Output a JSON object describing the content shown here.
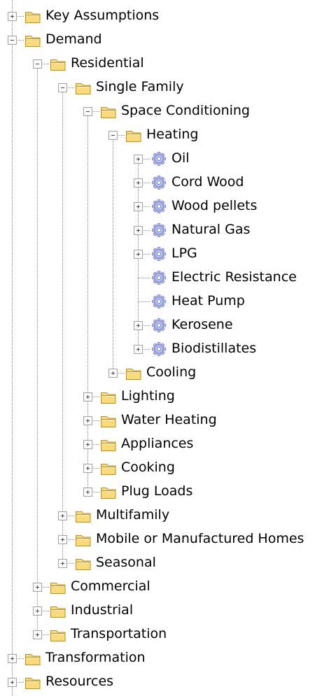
{
  "tree": {
    "items": [
      {
        "label": "Key Assumptions",
        "icon": "folder-icon",
        "state": "collapsed"
      },
      {
        "label": "Demand",
        "icon": "folder-icon",
        "state": "expanded"
      },
      {
        "label": "Residential",
        "icon": "folder-icon",
        "state": "expanded"
      },
      {
        "label": "Single Family",
        "icon": "folder-icon",
        "state": "expanded"
      },
      {
        "label": "Space Conditioning",
        "icon": "folder-icon",
        "state": "expanded"
      },
      {
        "label": "Heating",
        "icon": "folder-icon",
        "state": "expanded"
      },
      {
        "label": "Oil",
        "icon": "gear-icon",
        "state": "collapsed"
      },
      {
        "label": "Cord Wood",
        "icon": "gear-icon",
        "state": "collapsed"
      },
      {
        "label": "Wood pellets",
        "icon": "gear-icon",
        "state": "collapsed"
      },
      {
        "label": "Natural Gas",
        "icon": "gear-icon",
        "state": "collapsed"
      },
      {
        "label": "LPG",
        "icon": "gear-icon",
        "state": "collapsed"
      },
      {
        "label": "Electric Resistance",
        "icon": "gear-icon",
        "state": "leaf"
      },
      {
        "label": "Heat Pump",
        "icon": "gear-icon",
        "state": "leaf"
      },
      {
        "label": "Kerosene",
        "icon": "gear-icon",
        "state": "collapsed"
      },
      {
        "label": "Biodistillates",
        "icon": "gear-icon",
        "state": "collapsed"
      },
      {
        "label": "Cooling",
        "icon": "folder-icon",
        "state": "collapsed"
      },
      {
        "label": "Lighting",
        "icon": "folder-icon",
        "state": "collapsed"
      },
      {
        "label": "Water Heating",
        "icon": "folder-icon",
        "state": "collapsed"
      },
      {
        "label": "Appliances",
        "icon": "folder-icon",
        "state": "collapsed"
      },
      {
        "label": "Cooking",
        "icon": "folder-icon",
        "state": "collapsed"
      },
      {
        "label": "Plug Loads",
        "icon": "folder-icon",
        "state": "collapsed"
      },
      {
        "label": "Multifamily",
        "icon": "folder-icon",
        "state": "collapsed"
      },
      {
        "label": "Mobile or Manufactured Homes",
        "icon": "folder-icon",
        "state": "collapsed"
      },
      {
        "label": "Seasonal",
        "icon": "folder-icon",
        "state": "collapsed"
      },
      {
        "label": "Commercial",
        "icon": "folder-icon",
        "state": "collapsed"
      },
      {
        "label": "Industrial",
        "icon": "folder-icon",
        "state": "collapsed"
      },
      {
        "label": "Transportation",
        "icon": "folder-icon",
        "state": "collapsed"
      },
      {
        "label": "Transformation",
        "icon": "folder-icon",
        "state": "collapsed"
      },
      {
        "label": "Resources",
        "icon": "folder-icon",
        "state": "collapsed"
      }
    ]
  },
  "colors": {
    "folder_fill": "#f9da7c",
    "folder_edge": "#b8912a",
    "gear_fill": "#b7bff0",
    "gear_edge": "#6b76c2",
    "tree_lines": "#8a8a8a"
  }
}
